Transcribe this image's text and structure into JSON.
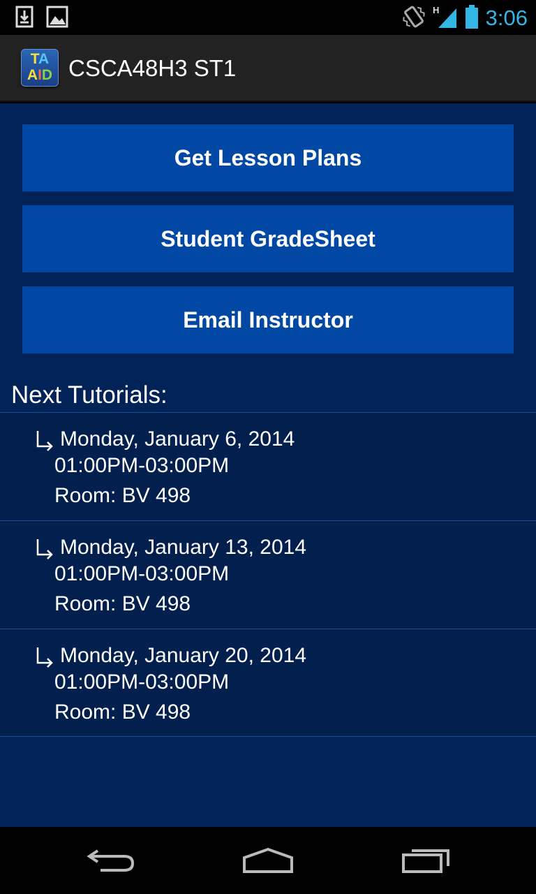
{
  "status_bar": {
    "time": "3:06",
    "network_label": "H",
    "left_icons": [
      "download-icon",
      "image-icon"
    ],
    "right_icons": [
      "vibrate-icon",
      "signal-icon",
      "battery-icon"
    ]
  },
  "action_bar": {
    "icon_top": "TA",
    "icon_bottom": "AID",
    "title": "CSCA48H3 ST1"
  },
  "buttons": {
    "lesson_plans": "Get Lesson Plans",
    "grade_sheet": "Student GradeSheet",
    "email_instructor": "Email Instructor"
  },
  "tutorials": {
    "heading": "Next Tutorials:",
    "items": [
      {
        "date": "Monday, January 6, 2014",
        "time": "01:00PM-03:00PM",
        "room": "Room: BV 498"
      },
      {
        "date": "Monday, January 13, 2014",
        "time": "01:00PM-03:00PM",
        "room": "Room: BV 498"
      },
      {
        "date": "Monday, January 20, 2014",
        "time": "01:00PM-03:00PM",
        "room": "Room: BV 498"
      }
    ]
  },
  "nav_bar": [
    "back-icon",
    "home-icon",
    "recent-apps-icon"
  ],
  "colors": {
    "background": "#022357",
    "button": "#0148a4",
    "action_bar": "#222222",
    "clock": "#33b5e5"
  }
}
